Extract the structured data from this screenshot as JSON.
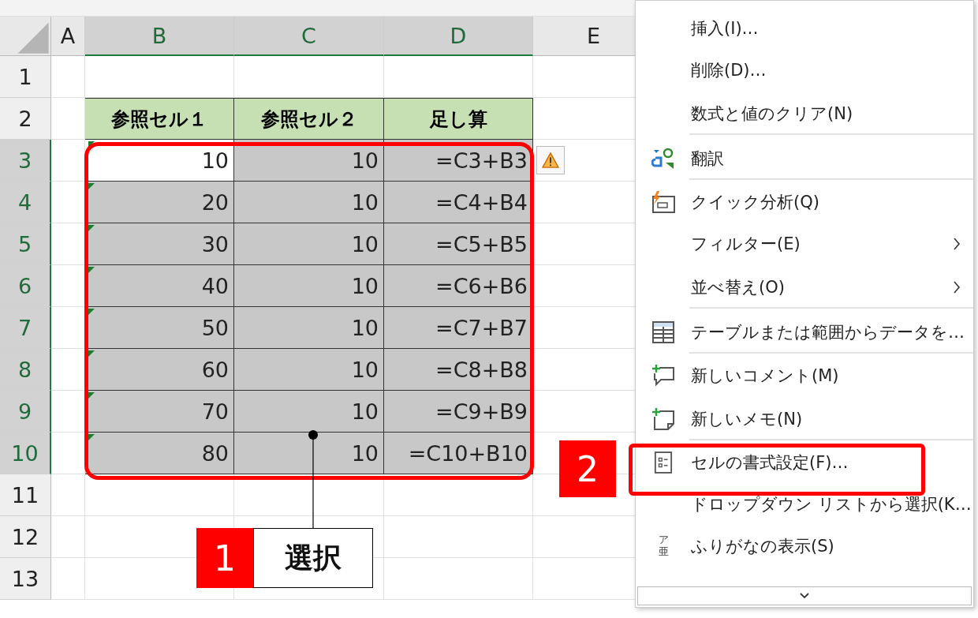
{
  "sheet": {
    "columns": [
      {
        "label": "A",
        "selected": false
      },
      {
        "label": "B",
        "selected": true
      },
      {
        "label": "C",
        "selected": true
      },
      {
        "label": "D",
        "selected": true
      },
      {
        "label": "E",
        "selected": false
      }
    ],
    "rows": [
      {
        "number": "1",
        "selected": false
      },
      {
        "number": "2",
        "selected": false,
        "headers": [
          "参照セル１",
          "参照セル２",
          "足し算"
        ]
      },
      {
        "number": "3",
        "selected": true,
        "warning": true,
        "cells": [
          {
            "text": "10",
            "active": true,
            "error_mark": true
          },
          {
            "text": "10",
            "active": false,
            "error_mark": false
          },
          {
            "text": "=C3+B3",
            "active": false,
            "error_mark": false
          }
        ]
      },
      {
        "number": "4",
        "selected": true,
        "cells": [
          {
            "text": "20",
            "active": false,
            "error_mark": true
          },
          {
            "text": "10",
            "active": false,
            "error_mark": false
          },
          {
            "text": "=C4+B4",
            "active": false,
            "error_mark": false
          }
        ]
      },
      {
        "number": "5",
        "selected": true,
        "cells": [
          {
            "text": "30",
            "active": false,
            "error_mark": true
          },
          {
            "text": "10",
            "active": false,
            "error_mark": false
          },
          {
            "text": "=C5+B5",
            "active": false,
            "error_mark": false
          }
        ]
      },
      {
        "number": "6",
        "selected": true,
        "cells": [
          {
            "text": "40",
            "active": false,
            "error_mark": true
          },
          {
            "text": "10",
            "active": false,
            "error_mark": false
          },
          {
            "text": "=C6+B6",
            "active": false,
            "error_mark": false
          }
        ]
      },
      {
        "number": "7",
        "selected": true,
        "cells": [
          {
            "text": "50",
            "active": false,
            "error_mark": true
          },
          {
            "text": "10",
            "active": false,
            "error_mark": false
          },
          {
            "text": "=C7+B7",
            "active": false,
            "error_mark": false
          }
        ]
      },
      {
        "number": "8",
        "selected": true,
        "cells": [
          {
            "text": "60",
            "active": false,
            "error_mark": true
          },
          {
            "text": "10",
            "active": false,
            "error_mark": false
          },
          {
            "text": "=C8+B8",
            "active": false,
            "error_mark": false
          }
        ]
      },
      {
        "number": "9",
        "selected": true,
        "cells": [
          {
            "text": "70",
            "active": false,
            "error_mark": true
          },
          {
            "text": "10",
            "active": false,
            "error_mark": false
          },
          {
            "text": "=C9+B9",
            "active": false,
            "error_mark": false
          }
        ]
      },
      {
        "number": "10",
        "selected": true,
        "cells": [
          {
            "text": "80",
            "active": false,
            "error_mark": true
          },
          {
            "text": "10",
            "active": false,
            "error_mark": false
          },
          {
            "text": "=C10+B10",
            "active": false,
            "error_mark": false
          }
        ]
      },
      {
        "number": "11",
        "selected": false
      },
      {
        "number": "12",
        "selected": false
      },
      {
        "number": "13",
        "selected": false
      }
    ]
  },
  "context_menu": {
    "items": [
      {
        "label": "挿入(I)…",
        "kind": "none",
        "submenu": false,
        "separator_after": false
      },
      {
        "label": "削除(D)…",
        "kind": "none",
        "submenu": false,
        "separator_after": false
      },
      {
        "label": "数式と値のクリア(N)",
        "kind": "none",
        "submenu": false,
        "separator_after": true
      },
      {
        "label": "翻訳",
        "kind": "translate",
        "submenu": false,
        "separator_after": true
      },
      {
        "label": "クイック分析(Q)",
        "kind": "quick",
        "submenu": false,
        "separator_after": false
      },
      {
        "label": "フィルター(E)",
        "kind": "none",
        "submenu": true,
        "separator_after": false
      },
      {
        "label": "並べ替え(O)",
        "kind": "none",
        "submenu": true,
        "separator_after": true
      },
      {
        "label": "テーブルまたは範囲からデータを…",
        "kind": "table",
        "submenu": false,
        "separator_after": true
      },
      {
        "label": "新しいコメント(M)",
        "kind": "comment",
        "submenu": false,
        "separator_after": false
      },
      {
        "label": "新しいメモ(N)",
        "kind": "note",
        "submenu": false,
        "separator_after": true
      },
      {
        "label": "セルの書式設定(F)…",
        "kind": "format",
        "submenu": false,
        "separator_after": false
      },
      {
        "label": "ドロップダウン リストから選択(K…",
        "kind": "none",
        "submenu": false,
        "separator_after": false
      },
      {
        "label": "ふりがなの表示(S)",
        "kind": "furigana",
        "icon_glyphs": [
          "ア",
          "亜"
        ],
        "submenu": false,
        "separator_after": false
      }
    ]
  },
  "callouts": [
    {
      "number": "1",
      "label": "選択"
    },
    {
      "number": "2"
    }
  ]
}
